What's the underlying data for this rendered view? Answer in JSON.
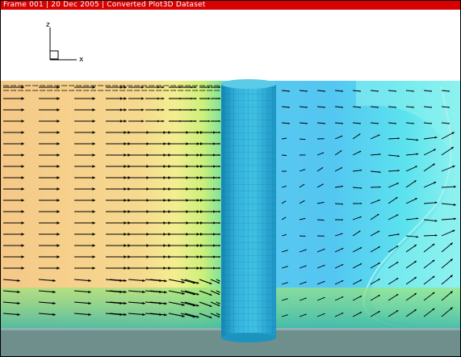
{
  "window": {
    "title": "Frame 001  |  20 Dec 2005  |  Converted Plot3D Dataset"
  },
  "axes": {
    "z_label": "z",
    "x_label": "x"
  },
  "colors": {
    "title_bar": "#d80000",
    "title_text": "#ffffff",
    "cylinder": "#2aa9cf",
    "vector_arrows": "#000000",
    "floor": "#6f8f8d",
    "background": "#ffffff"
  },
  "icons": {
    "axis_triad": "xz-axis-triad-icon"
  }
}
